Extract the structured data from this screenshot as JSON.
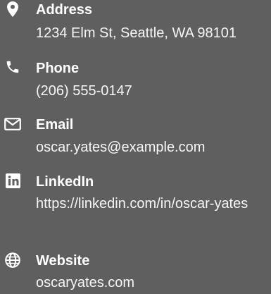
{
  "contact": {
    "address": {
      "title": "Address",
      "value": "1234 Elm St, Seattle, WA 98101",
      "icon": "map-marker-icon"
    },
    "phone": {
      "title": "Phone",
      "value": "(206) 555-0147",
      "icon": "phone-icon"
    },
    "email": {
      "title": "Email",
      "value": "oscar.yates@example.com",
      "icon": "envelope-icon"
    },
    "linkedin": {
      "title": "LinkedIn",
      "value": "https://linkedin.com/in/oscar-yates",
      "icon": "linkedin-icon"
    },
    "website": {
      "title": "Website",
      "value": "oscaryates.com",
      "icon": "globe-icon"
    }
  },
  "colors": {
    "background": "#5f5f5f",
    "text": "#ffffff"
  }
}
